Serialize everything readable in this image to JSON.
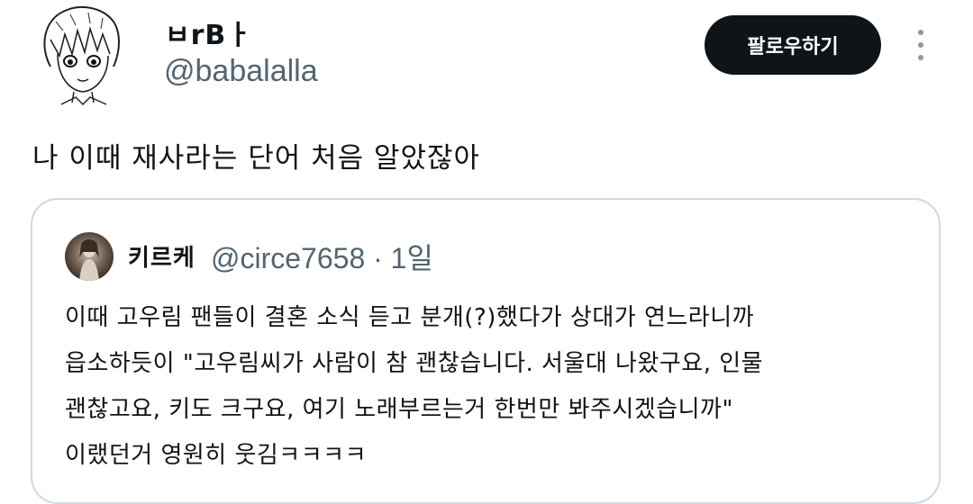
{
  "author": {
    "display_name": "ㅂrBㅏ",
    "handle": "@babalalla"
  },
  "follow_button_label": "팔로우하기",
  "more_icon": "more-vertical-icon",
  "tweet": {
    "text": "나 이때 재사라는 단어 처음 알았잖아"
  },
  "quote": {
    "display_name": "키르케",
    "handle": "@circe7658",
    "separator": "·",
    "time": "1일",
    "lines": [
      "이때 고우림 팬들이 결혼 소식 듣고 분개(?)했다가 상대가 연느라니까",
      "읍소하듯이 \"고우림씨가 사람이 참 괜찮습니다. 서울대 나왔구요, 인물",
      "괜찮고요, 키도 크구요, 여기 노래부르는거 한번만 봐주시겠습니까\"",
      "이랬던거 영원히 웃김ㅋㅋㅋㅋ"
    ]
  },
  "colors": {
    "text": "#0f1419",
    "secondary": "#536471",
    "border": "#cfd9de",
    "button_bg": "#0f1419"
  }
}
